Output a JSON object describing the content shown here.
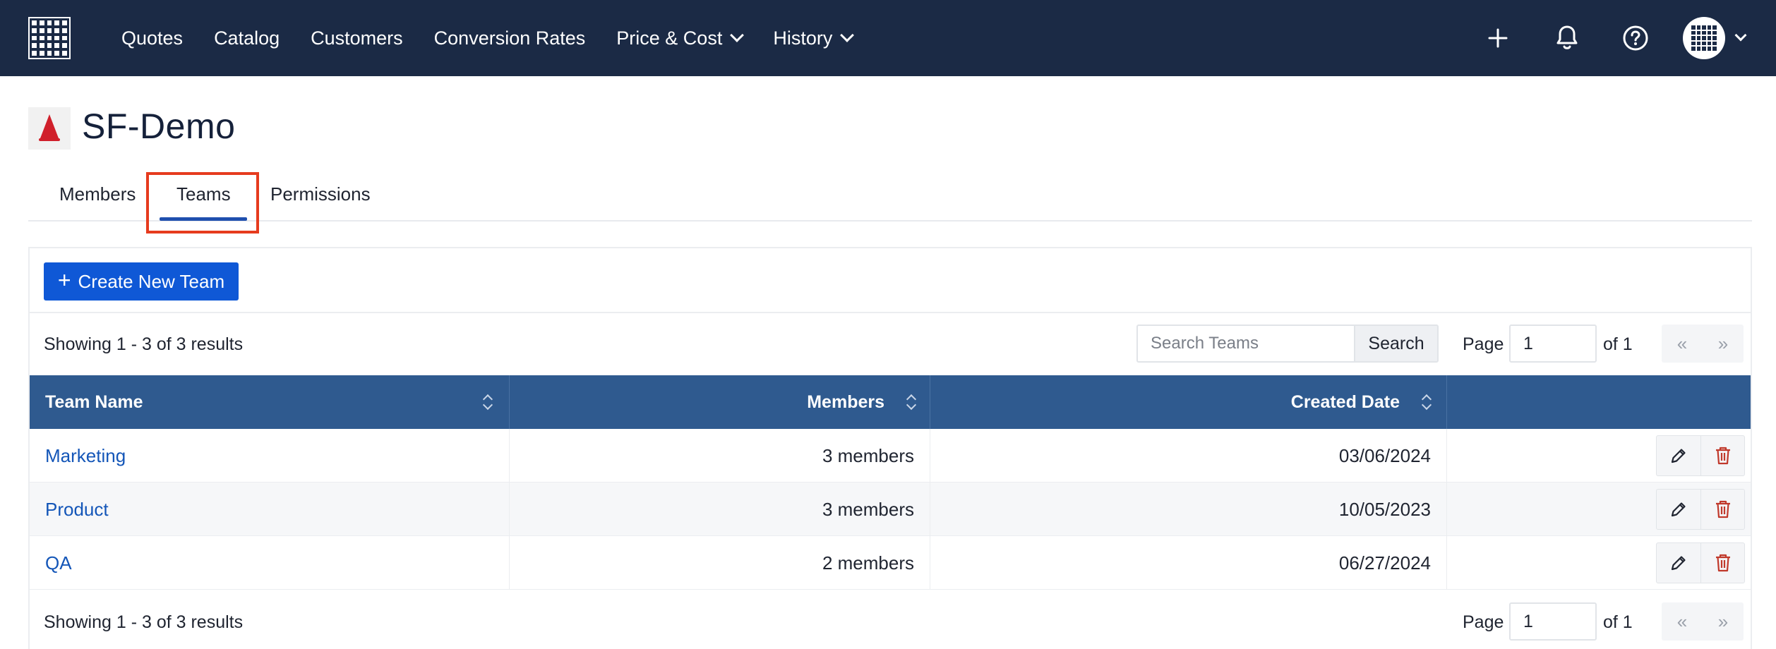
{
  "nav": {
    "items": [
      {
        "label": "Quotes",
        "dropdown": false
      },
      {
        "label": "Catalog",
        "dropdown": false
      },
      {
        "label": "Customers",
        "dropdown": false
      },
      {
        "label": "Conversion Rates",
        "dropdown": false
      },
      {
        "label": "Price & Cost",
        "dropdown": true
      },
      {
        "label": "History",
        "dropdown": true
      }
    ],
    "icons": [
      "plus-icon",
      "bell-icon",
      "help-icon",
      "avatar-grid-icon"
    ]
  },
  "header": {
    "title": "SF-Demo"
  },
  "tabs": [
    {
      "label": "Members",
      "active": false
    },
    {
      "label": "Teams",
      "active": true
    },
    {
      "label": "Permissions",
      "active": false
    }
  ],
  "toolbar": {
    "create_label": "Create New Team",
    "showing_top": "Showing 1 - 3 of 3 results",
    "showing_bottom": "Showing 1 - 3 of 3 results",
    "search_placeholder": "Search Teams",
    "search_label": "Search",
    "page_label": "Page",
    "page_value": "1",
    "of_label": "of 1",
    "prev": "«",
    "next": "»"
  },
  "table": {
    "columns": [
      "Team Name",
      "Members",
      "Created Date",
      ""
    ],
    "rows": [
      {
        "name": "Marketing",
        "members": "3 members",
        "created": "03/06/2024"
      },
      {
        "name": "Product",
        "members": "3 members",
        "created": "10/05/2023"
      },
      {
        "name": "QA",
        "members": "2 members",
        "created": "06/27/2024"
      }
    ]
  },
  "colors": {
    "nav_bg": "#1b2a45",
    "primary": "#0f58d6",
    "table_header": "#2f5a8f",
    "link": "#1456b8",
    "delete": "#c0392b",
    "highlight": "#e63b1e"
  }
}
